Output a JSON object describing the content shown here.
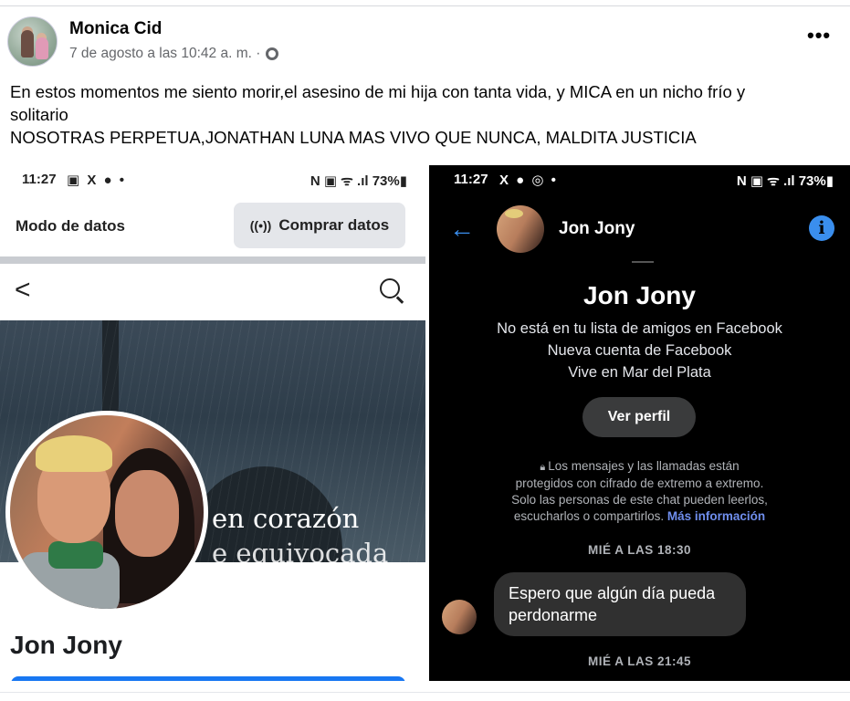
{
  "post": {
    "author": "Monica Cid",
    "timestamp": "7 de agosto a las 10:42 a. m. ·",
    "more_label": "•••",
    "text_line1": "En estos momentos me siento morir,el asesino de mi hija con tanta vida, y MICA en un nicho frío y",
    "text_line2": "solitario",
    "text_line3": "NOSOTRAS PERPETUA,JONATHAN LUNA MAS VIVO QUE NUNCA, MALDITA JUSTICIA"
  },
  "left_screenshot": {
    "status_time": "11:27",
    "status_icons": "▣ X ● •",
    "status_right": "N ▣ ᯤ .ıl 73%▮",
    "data_mode_label": "Modo de datos",
    "buy_data_label": "Comprar datos",
    "back_glyph": "<",
    "cover_text1": "en corazón",
    "cover_text2": "e equivocada",
    "profile_name": "Jon Jony"
  },
  "right_screenshot": {
    "status_time": "11:27",
    "status_icons": "X ● ◎ •",
    "status_right": "N ▣ ᯤ .ıl 73%▮",
    "back_glyph": "←",
    "chat_name": "Jon Jony",
    "info_glyph": "i",
    "big_name": "Jon Jony",
    "info1": "No está en tu lista de amigos en Facebook",
    "info2": "Nueva cuenta de Facebook",
    "info3": "Vive en Mar del Plata",
    "view_profile_label": "Ver perfil",
    "encryption_line1": "Los mensajes y las llamadas están",
    "encryption_line2": "protegidos con cifrado de extremo a extremo.",
    "encryption_line3": "Solo las personas de este chat pueden leerlos,",
    "encryption_line4": "escucharlos o compartirlos.",
    "encryption_link": "Más información",
    "timestamp1": "MIÉ A LAS 18:30",
    "message_line1": "Espero que algún día pueda",
    "message_line2": "perdonarme",
    "timestamp2": "MIÉ A LAS 21:45"
  },
  "colors": {
    "messenger_blue": "#3a8eed",
    "facebook_blue": "#1877f2",
    "dark_bg": "#000000",
    "bubble_bg": "#303030"
  }
}
